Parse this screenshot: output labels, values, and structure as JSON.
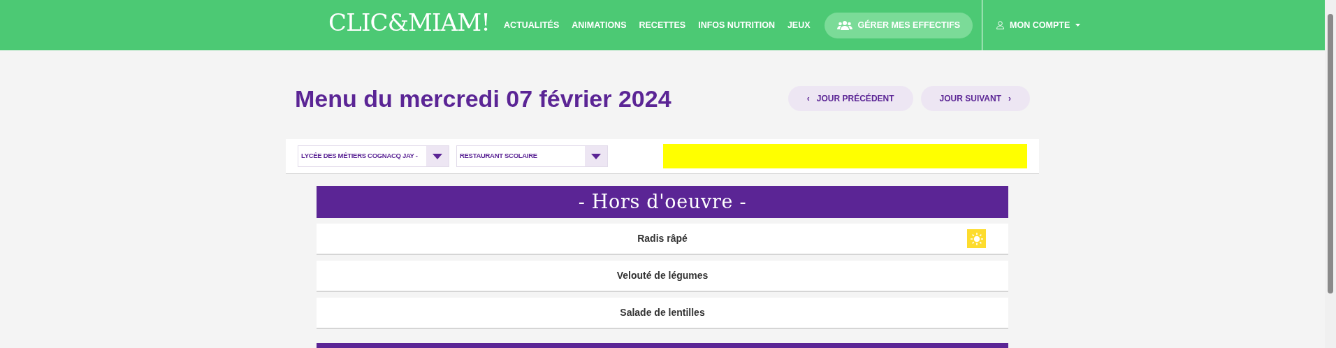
{
  "header": {
    "logo": "CLIC&MIAM!",
    "nav": [
      "ACTUALITÉS",
      "ANIMATIONS",
      "RECETTES",
      "INFOS NUTRITION",
      "JEUX"
    ],
    "cta": "GÉRER MES EFFECTIFS",
    "account": "MON COMPTE"
  },
  "title": "Menu du mercredi 07 février 2024",
  "day_buttons": [
    {
      "kind": "prev",
      "label": "JOUR PRÉCÉDENT",
      "arrow": "‹"
    },
    {
      "kind": "next",
      "label": "JOUR SUIVANT",
      "arrow": "›"
    }
  ],
  "filters": [
    {
      "value": "LYCÉE DES MÉTIERS COGNACQ JAY -"
    },
    {
      "value": "RESTAURANT SCOLAIRE"
    }
  ],
  "sections": [
    {
      "title": "- Hors d'oeuvre -",
      "items": [
        {
          "name": "Radis râpé",
          "seasonal": true
        },
        {
          "name": "Velouté de légumes",
          "seasonal": false
        },
        {
          "name": "Salade de lentilles",
          "seasonal": false
        }
      ]
    }
  ]
}
